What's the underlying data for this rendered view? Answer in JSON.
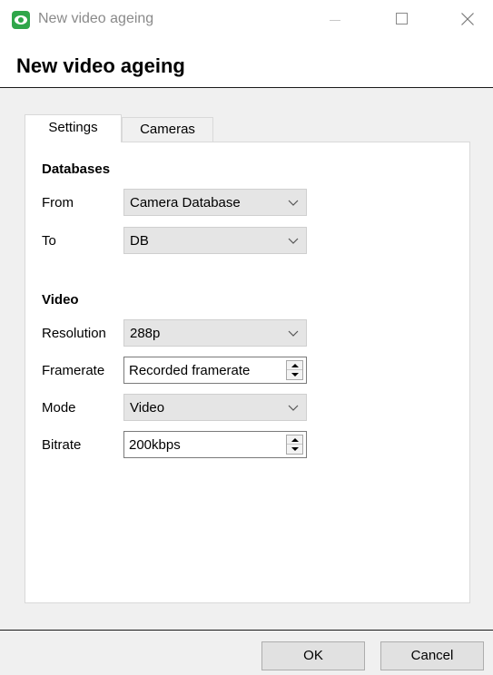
{
  "window": {
    "title": "New video ageing",
    "app_icon": "eye-icon",
    "controls": [
      "minimize-icon",
      "maximize-icon",
      "close-icon"
    ]
  },
  "heading": "New video ageing",
  "tabs": [
    {
      "label": "Settings",
      "selected": true
    },
    {
      "label": "Cameras",
      "selected": false
    }
  ],
  "databases": {
    "title": "Databases",
    "from_label": "From",
    "from_value": "Camera Database",
    "to_label": "To",
    "to_value": "DB"
  },
  "video": {
    "title": "Video",
    "resolution_label": "Resolution",
    "resolution_value": "288p",
    "framerate_label": "Framerate",
    "framerate_value": "Recorded framerate",
    "mode_label": "Mode",
    "mode_value": "Video",
    "bitrate_label": "Bitrate",
    "bitrate_value": "200kbps"
  },
  "buttons": {
    "ok": "OK",
    "cancel": "Cancel"
  },
  "colors": {
    "app_icon": "#2fa64a",
    "content_bg": "#f0f0f0",
    "combo_bg": "#e5e5e5"
  }
}
